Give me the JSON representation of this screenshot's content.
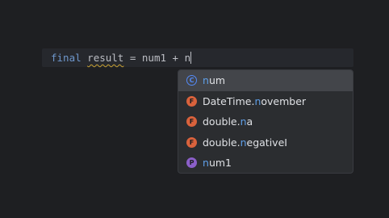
{
  "editor": {
    "code": {
      "keyword": "final",
      "variable": "result",
      "rest": " = num1 + n"
    }
  },
  "completion": {
    "items": [
      {
        "kind": "class",
        "icon": "C",
        "prefix": "",
        "match": "n",
        "suffix": "um",
        "selected": true
      },
      {
        "kind": "field",
        "icon": "F",
        "prefix": "DateTime.",
        "match": "n",
        "suffix": "ovember",
        "selected": false
      },
      {
        "kind": "field",
        "icon": "F",
        "prefix": "double.",
        "match": "n",
        "suffix": "a",
        "selected": false
      },
      {
        "kind": "field",
        "icon": "F",
        "prefix": "double.",
        "match": "n",
        "suffix": "egativeI",
        "selected": false
      },
      {
        "kind": "parameter",
        "icon": "P",
        "prefix": "",
        "match": "n",
        "suffix": "um1",
        "selected": false
      }
    ]
  },
  "colors": {
    "background": "#1e1f22",
    "keyword": "#6e97cc",
    "match_highlight": "#5f9fe8",
    "warning_squiggle": "#c9a333",
    "class_icon": "#548af7",
    "field_icon": "#d9623c",
    "parameter_icon": "#8b5fc9"
  }
}
